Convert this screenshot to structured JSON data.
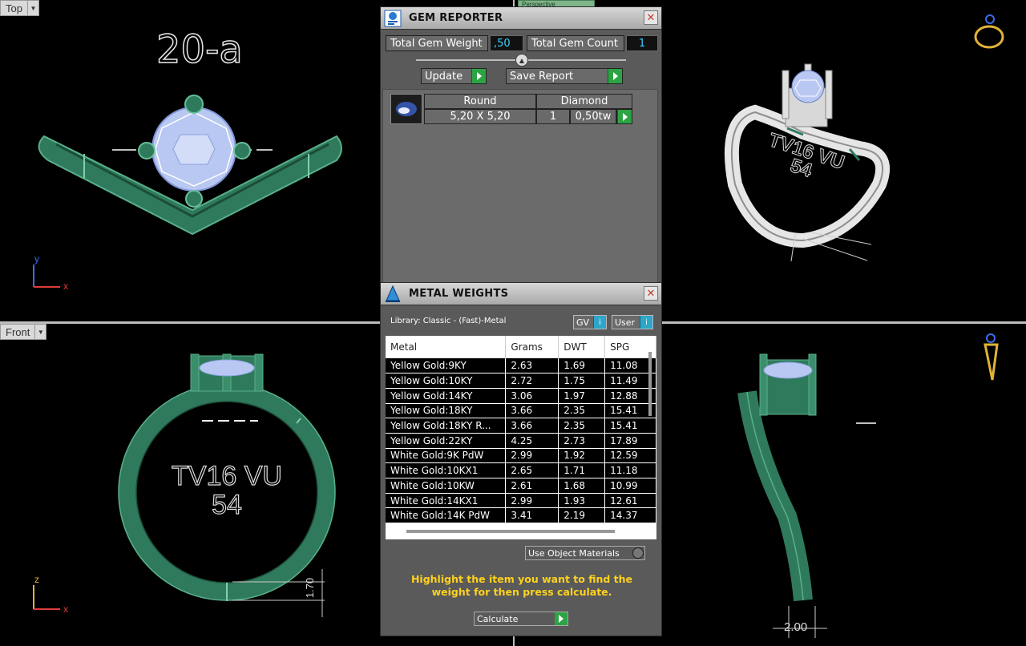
{
  "viewports": {
    "top": {
      "label": "Top",
      "annotation": "20-a"
    },
    "front": {
      "label": "Front",
      "engraving_line1": "TV16 VU",
      "engraving_line2": "54",
      "dimension": "1.70"
    },
    "perspective": {
      "label": "Perspective",
      "engraving_line1": "TV16 VU",
      "engraving_line2": "54"
    },
    "right": {
      "dimension": "2.00"
    }
  },
  "axes": {
    "top_v": "y",
    "top_h": "x",
    "front_v": "z",
    "front_h": "x"
  },
  "colors": {
    "ring_green": "#2f7a5c",
    "gem_blue": "#b9c8f2",
    "accent_cyan": "#3ed0ff",
    "hint_yellow": "#ffd21e",
    "go_green": "#2da443"
  },
  "gem_reporter": {
    "title": "GEM REPORTER",
    "total_weight_label": "Total Gem Weight",
    "total_weight_value": ",50",
    "total_count_label": "Total Gem Count",
    "total_count_value": "1",
    "update_label": "Update",
    "save_report_label": "Save Report",
    "gem": {
      "shape": "Round",
      "type": "Diamond",
      "size": "5,20 X 5,20",
      "count": "1",
      "weight": "0,50tw"
    }
  },
  "metal_weights": {
    "title": "METAL WEIGHTS",
    "library": "Library: Classic - (Fast)-Metal",
    "gv_label": "GV",
    "user_label": "User",
    "columns": [
      "Metal",
      "Grams",
      "DWT",
      "SPG"
    ],
    "rows": [
      [
        "Yellow Gold:9KY",
        "2.63",
        "1.69",
        "11.08"
      ],
      [
        "Yellow Gold:10KY",
        "2.72",
        "1.75",
        "11.49"
      ],
      [
        "Yellow Gold:14KY",
        "3.06",
        "1.97",
        "12.88"
      ],
      [
        "Yellow Gold:18KY",
        "3.66",
        "2.35",
        "15.41"
      ],
      [
        "Yellow Gold:18KY R...",
        "3.66",
        "2.35",
        "15.41"
      ],
      [
        "Yellow Gold:22KY",
        "4.25",
        "2.73",
        "17.89"
      ],
      [
        "White Gold:9K PdW",
        "2.99",
        "1.92",
        "12.59"
      ],
      [
        "White Gold:10KX1",
        "2.65",
        "1.71",
        "11.18"
      ],
      [
        "White Gold:10KW",
        "2.61",
        "1.68",
        "10.99"
      ],
      [
        "White Gold:14KX1",
        "2.99",
        "1.93",
        "12.61"
      ],
      [
        "White Gold:14K PdW",
        "3.41",
        "2.19",
        "14.37"
      ]
    ],
    "use_object_materials": "Use Object Materials",
    "hint": "Highlight the item you want to find the weight for then press calculate.",
    "calculate_label": "Calculate"
  }
}
